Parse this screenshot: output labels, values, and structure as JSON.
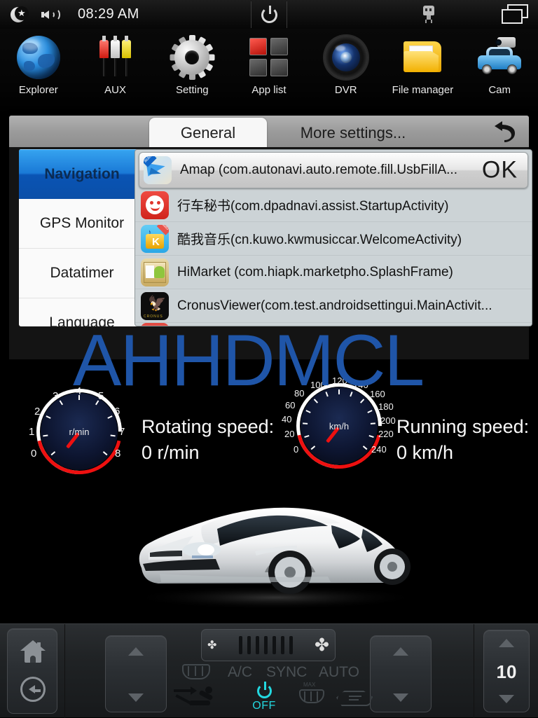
{
  "status_bar": {
    "night_icon": "moon-star-icon",
    "volume_icon": "volume-icon",
    "time": "08:29 AM",
    "power_icon": "power-icon",
    "usb_icon": "usb-icon",
    "recents_icon": "recents-icon"
  },
  "app_dock": {
    "items": [
      {
        "label": "Explorer",
        "icon": "globe-icon"
      },
      {
        "label": "AUX",
        "icon": "rca-plugs-icon"
      },
      {
        "label": "Setting",
        "icon": "gear-icon"
      },
      {
        "label": "App list",
        "icon": "grid-squares-icon"
      },
      {
        "label": "DVR",
        "icon": "camera-lens-icon"
      },
      {
        "label": "File manager",
        "icon": "folder-icon"
      },
      {
        "label": "Cam",
        "icon": "car-camera-icon"
      }
    ]
  },
  "settings": {
    "tabs": [
      {
        "label": "General",
        "active": true
      },
      {
        "label": "More settings...",
        "active": false
      }
    ],
    "back_icon": "back-arrow-icon",
    "sidebar": [
      {
        "label": "Navigation",
        "active": true
      },
      {
        "label": "GPS Monitor",
        "active": false
      },
      {
        "label": "Datatimer",
        "active": false
      },
      {
        "label": "Language",
        "active": false
      }
    ],
    "app_list": {
      "ok_label": "OK",
      "selected": {
        "label": "Amap (com.autonavi.auto.remote.fill.UsbFillA...",
        "icon": "amap-icon"
      },
      "rows": [
        {
          "label": "行车秘书(com.dpadnavi.assist.StartupActivity)",
          "icon": "xingche-mishu-icon"
        },
        {
          "label": "酷我音乐(cn.kuwo.kwmusiccar.WelcomeActivity)",
          "icon": "kuwo-music-icon"
        },
        {
          "label": "HiMarket (com.hiapk.marketpho.SplashFrame)",
          "icon": "himarket-icon"
        },
        {
          "label": "CronusViewer(com.test.androidsettingui.MainActivit...",
          "icon": "cronus-viewer-icon"
        }
      ]
    }
  },
  "watermark": {
    "text": "AHHDMCL",
    "color": "#1f55a8"
  },
  "dashboard": {
    "tacho": {
      "unit": "r/min",
      "ticks": [
        "0",
        "1",
        "2",
        "3",
        "4",
        "5",
        "6",
        "7",
        "8"
      ],
      "readout_label": "Rotating speed:",
      "readout_value": "0 r/min"
    },
    "speedo": {
      "unit": "km/h",
      "ticks": [
        "0",
        "20",
        "40",
        "60",
        "80",
        "100",
        "120",
        "140",
        "160",
        "180",
        "200",
        "220",
        "240"
      ],
      "readout_label": "Running speed:",
      "readout_value": "0 km/h"
    },
    "car_photo": "white-sedan-photo"
  },
  "climate_bar": {
    "home_icon": "home-icon",
    "back_icon": "back-circle-icon",
    "temp_left_button": "temp-left-stepper",
    "temp_right_button": "temp-right-stepper",
    "fan_small_icon": "fan-icon-small",
    "fan_large_icon": "fan-icon-large",
    "fan_bars": 7,
    "ac_label": "A/C",
    "sync_label": "SYNC",
    "auto_label": "AUTO",
    "rear_defrost_icon": "rear-defrost-icon",
    "max_defrost_icon": "max-defrost-icon",
    "max_label": "MAX",
    "airflow_icon": "airflow-direction-icon",
    "recirculate_icon": "air-recirculate-icon",
    "power_state": "OFF",
    "power_color": "#23d8e0",
    "volume_value": "10"
  }
}
